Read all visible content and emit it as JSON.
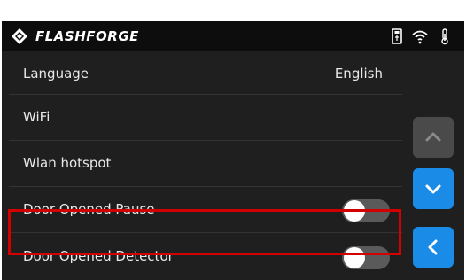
{
  "header": {
    "brand": "FLASHFORGE",
    "logo_icon": "flashforge-logo-icon",
    "status_icons": [
      "usb-drive-icon",
      "wifi-icon",
      "thermometer-icon"
    ]
  },
  "settings": [
    {
      "label": "Language",
      "value": "English",
      "type": "value"
    },
    {
      "label": "WiFi",
      "type": "link"
    },
    {
      "label": "Wlan hotspot",
      "type": "link"
    },
    {
      "label": "Door Opened Pause",
      "type": "toggle",
      "on": false
    },
    {
      "label": "Door Opened Detector",
      "type": "toggle",
      "on": false,
      "highlighted": true
    }
  ],
  "nav": {
    "up_icon": "chevron-up-icon",
    "down_icon": "chevron-down-icon",
    "back_icon": "chevron-left-icon"
  },
  "colors": {
    "accent": "#1a8be6",
    "highlight": "#d40000",
    "background": "#1f1f1f",
    "header": "#0d0d0d"
  }
}
